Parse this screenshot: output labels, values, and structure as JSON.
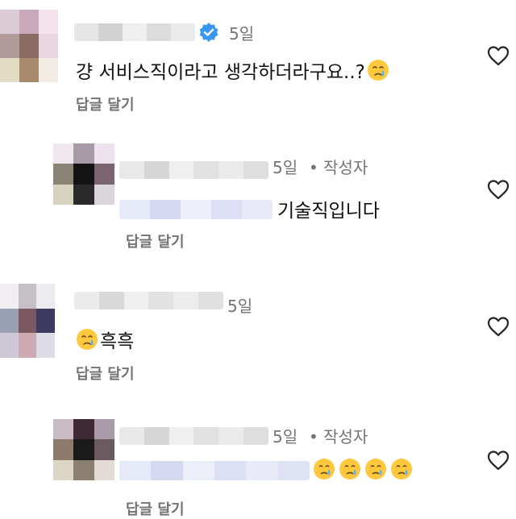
{
  "comments": [
    {
      "time": "5일",
      "text": "걍 서비스직이라고 생각하더라구요..?",
      "reply_label": "답글 달기",
      "verified": true,
      "emoji_count": 1
    },
    {
      "time": "5일",
      "author_badge": "• 작성자",
      "text": "기술직입니다",
      "reply_label": "답글 달기"
    },
    {
      "time": "5일",
      "text": "흑흑",
      "reply_label": "답글 달기",
      "emoji_prefix": "crying-face-icon"
    },
    {
      "time": "5일",
      "author_badge": "• 작성자",
      "text": "",
      "reply_label": "답글 달기",
      "emoji_count": 4
    }
  ],
  "icons": {
    "like": "heart-outline-icon",
    "verified": "verified-badge-icon",
    "emoji": "crying-face-icon"
  },
  "colors": {
    "secondary_text": "#737373",
    "verified_blue": "#3897f0",
    "primary_text": "#111111"
  }
}
